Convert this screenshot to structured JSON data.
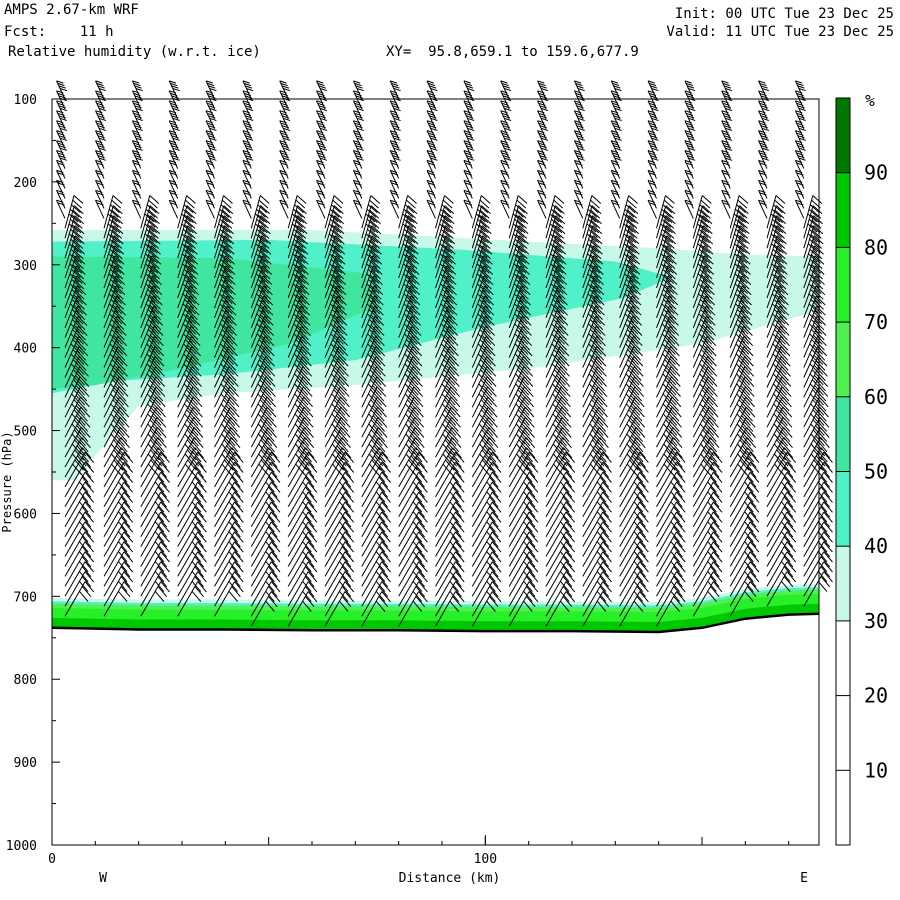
{
  "header": {
    "model": "AMPS 2.67-km WRF",
    "fcst": "Fcst:    11 h",
    "field": "Relative humidity (w.r.t. ice)",
    "xy": "XY=  95.8,659.1 to 159.6,677.9",
    "init": "Init: 00 UTC Tue 23 Dec 25",
    "valid": "Valid: 11 UTC Tue 23 Dec 25"
  },
  "chart_data": {
    "type": "heatmap",
    "title": "Relative humidity (w.r.t. ice)",
    "xlabel": "Distance (km)",
    "ylabel": "Pressure (hPa)",
    "xlim": [
      0,
      177
    ],
    "ylim": [
      1000,
      100
    ],
    "x_ticks": [
      0,
      100
    ],
    "y_ticks": [
      100,
      200,
      300,
      400,
      500,
      600,
      700,
      800,
      900,
      1000
    ],
    "x_end_labels": {
      "left": "W",
      "right": "E"
    },
    "colorbar": {
      "unit": "%",
      "levels": [
        10,
        20,
        30,
        40,
        50,
        60,
        70,
        80,
        90
      ],
      "bands": [
        {
          "from": 0,
          "to": 30,
          "color": "#ffffff"
        },
        {
          "from": 30,
          "to": 40,
          "color": "#c8f8e8"
        },
        {
          "from": 40,
          "to": 50,
          "color": "#50f0c8"
        },
        {
          "from": 50,
          "to": 60,
          "color": "#40e6a0"
        },
        {
          "from": 60,
          "to": 70,
          "color": "#50f050"
        },
        {
          "from": 70,
          "to": 80,
          "color": "#28f028"
        },
        {
          "from": 80,
          "to": 90,
          "color": "#00c800"
        },
        {
          "from": 90,
          "to": 100,
          "color": "#007800"
        }
      ]
    },
    "terrain_surface": {
      "x": [
        0,
        20,
        40,
        60,
        80,
        100,
        120,
        140,
        150,
        160,
        170,
        177
      ],
      "p": [
        738,
        740,
        740,
        741,
        741,
        742,
        742,
        743,
        738,
        727,
        722,
        721
      ]
    },
    "moist_regions": [
      {
        "level": "30-40",
        "note": "upper layer",
        "x": [
          0,
          177
        ],
        "p": [
          260,
          560
        ]
      },
      {
        "level": "40-50",
        "note": "upper layer",
        "x": [
          0,
          145
        ],
        "p": [
          280,
          510
        ]
      },
      {
        "level": "50-60",
        "note": "upper layer",
        "x": [
          0,
          70
        ],
        "p": [
          300,
          470
        ]
      },
      {
        "level": "60-90",
        "note": "near-surface",
        "x": [
          0,
          177
        ],
        "p": [
          705,
          742
        ]
      }
    ],
    "wind_barb_columns_x": [
      3,
      12,
      20.5,
      29,
      37.5,
      46,
      54.5,
      63,
      71.5,
      80,
      88.5,
      97,
      105.5,
      114,
      122.5,
      131,
      139.5,
      148,
      156.5,
      165,
      173.5
    ]
  }
}
